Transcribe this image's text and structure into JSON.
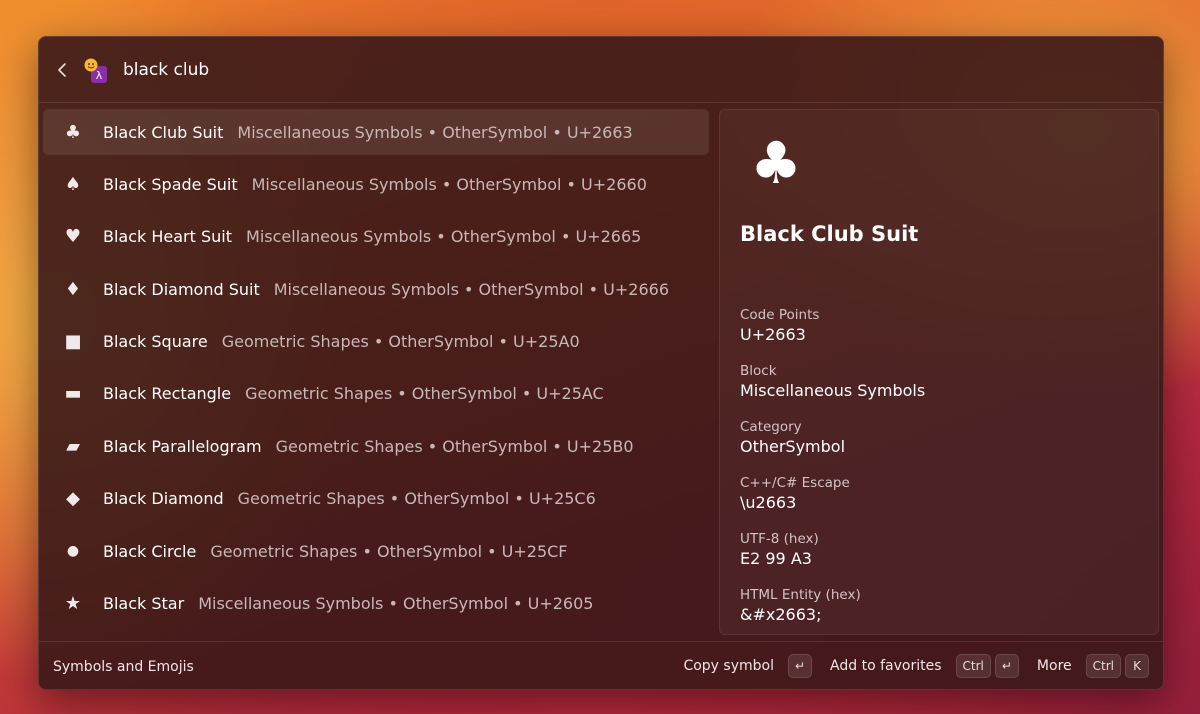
{
  "search": {
    "value": "black club"
  },
  "results": [
    {
      "glyph": "♣",
      "name": "Black Club Suit",
      "subtitle": "Miscellaneous Symbols • OtherSymbol • U+2663",
      "selected": true
    },
    {
      "glyph": "♠",
      "name": "Black Spade Suit",
      "subtitle": "Miscellaneous Symbols • OtherSymbol • U+2660"
    },
    {
      "glyph": "♥",
      "name": "Black Heart Suit",
      "subtitle": "Miscellaneous Symbols • OtherSymbol • U+2665"
    },
    {
      "glyph": "♦",
      "name": "Black Diamond Suit",
      "subtitle": "Miscellaneous Symbols • OtherSymbol • U+2666"
    },
    {
      "glyph": "■",
      "name": "Black Square",
      "subtitle": "Geometric Shapes • OtherSymbol • U+25A0"
    },
    {
      "glyph": "▬",
      "name": "Black Rectangle",
      "subtitle": "Geometric Shapes • OtherSymbol • U+25AC"
    },
    {
      "glyph": "▰",
      "name": "Black Parallelogram",
      "subtitle": "Geometric Shapes • OtherSymbol • U+25B0"
    },
    {
      "glyph": "◆",
      "name": "Black Diamond",
      "subtitle": "Geometric Shapes • OtherSymbol • U+25C6"
    },
    {
      "glyph": "●",
      "name": "Black Circle",
      "subtitle": "Geometric Shapes • OtherSymbol • U+25CF"
    },
    {
      "glyph": "★",
      "name": "Black Star",
      "subtitle": "Miscellaneous Symbols • OtherSymbol • U+2605"
    }
  ],
  "detail": {
    "glyph": "♣",
    "title": "Black Club Suit",
    "properties": [
      {
        "label": "Code Points",
        "value": "U+2663"
      },
      {
        "label": "Block",
        "value": "Miscellaneous Symbols"
      },
      {
        "label": "Category",
        "value": "OtherSymbol"
      },
      {
        "label": "C++/C# Escape",
        "value": "\\u2663"
      },
      {
        "label": "UTF-8 (hex)",
        "value": "E2 99 A3"
      },
      {
        "label": "HTML Entity (hex)",
        "value": "&#x2663;"
      }
    ]
  },
  "footer": {
    "title": "Symbols and Emojis",
    "copy_label": "Copy symbol",
    "favorites_label": "Add to favorites",
    "more_label": "More",
    "ctrl_key": "Ctrl",
    "enter_key": "↵",
    "k_key": "K"
  }
}
